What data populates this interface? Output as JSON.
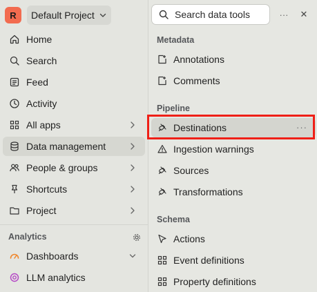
{
  "project": {
    "avatar_letter": "R",
    "name": "Default Project"
  },
  "nav": {
    "items": [
      {
        "label": "Home"
      },
      {
        "label": "Search"
      },
      {
        "label": "Feed"
      },
      {
        "label": "Activity"
      },
      {
        "label": "All apps"
      },
      {
        "label": "Data management"
      },
      {
        "label": "People & groups"
      },
      {
        "label": "Shortcuts"
      },
      {
        "label": "Project"
      }
    ]
  },
  "analytics": {
    "section_label": "Analytics",
    "items": [
      {
        "label": "Dashboards"
      },
      {
        "label": "LLM analytics"
      }
    ]
  },
  "panel": {
    "search_placeholder": "Search data tools",
    "more_glyph": "···",
    "close_glyph": "✕",
    "sections": [
      {
        "title": "Metadata",
        "items": [
          {
            "label": "Annotations"
          },
          {
            "label": "Comments"
          }
        ]
      },
      {
        "title": "Pipeline",
        "items": [
          {
            "label": "Destinations"
          },
          {
            "label": "Ingestion warnings"
          },
          {
            "label": "Sources"
          },
          {
            "label": "Transformations"
          }
        ]
      },
      {
        "title": "Schema",
        "items": [
          {
            "label": "Actions"
          },
          {
            "label": "Event definitions"
          },
          {
            "label": "Property definitions"
          }
        ]
      }
    ],
    "item_more_glyph": "···"
  },
  "colors": {
    "avatar": "#f26b4f",
    "highlight_box": "#ef1f17",
    "background": "#e4e5e0"
  }
}
